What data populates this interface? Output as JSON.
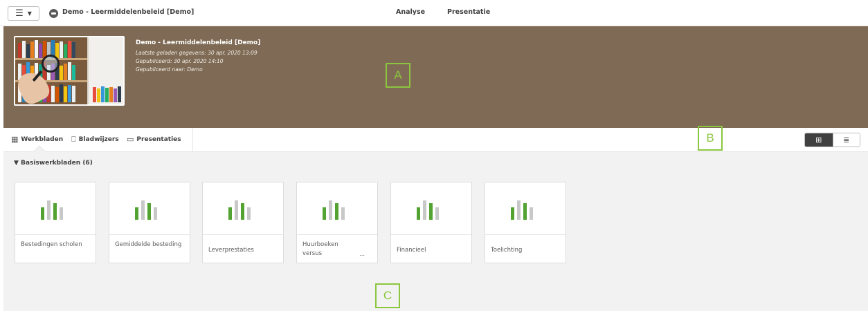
{
  "topbar": {
    "menu_icon": "hamburger-icon",
    "app_title": "Demo - Leermiddelenbeleid [Demo]",
    "nav": [
      "Analyse",
      "Presentatie"
    ]
  },
  "hero": {
    "title": "Demo - Leermiddelenbeleid [Demo]",
    "meta": [
      "Laatste geladen gegevens: 30 apr. 2020 13:09",
      "Gepubliceerd: 30 apr. 2020 14:10",
      "Gepubliceerd naar: Demo"
    ],
    "background_color": "#7f6b55"
  },
  "callouts": {
    "a": "A",
    "b": "B",
    "c": "C"
  },
  "tabs": [
    {
      "label": "Werkbladen",
      "icon": "sheets-icon"
    },
    {
      "label": "Bladwijzers",
      "icon": "bookmark-icon"
    },
    {
      "label": "Presentaties",
      "icon": "presentation-icon"
    }
  ],
  "view_toggle": {
    "grid_icon": "grid-icon",
    "list_icon": "list-icon",
    "active": "grid"
  },
  "section": {
    "title": "▼ Basiswerkbladen (6)"
  },
  "sheets": [
    {
      "label": "Bestedingen scholen",
      "truncated": false
    },
    {
      "label": "Gemiddelde besteding",
      "truncated": false
    },
    {
      "label": "Leverprestaties",
      "truncated": false
    },
    {
      "label": "Huurboeken versus",
      "truncated": true,
      "ellipsis": "..."
    },
    {
      "label": "Financieel",
      "truncated": false
    },
    {
      "label": "Toelichting",
      "truncated": false
    }
  ],
  "colors": {
    "accent_green": "#52a331",
    "bar_gray": "#c8c8c8",
    "callout_green": "#8cc63f"
  }
}
